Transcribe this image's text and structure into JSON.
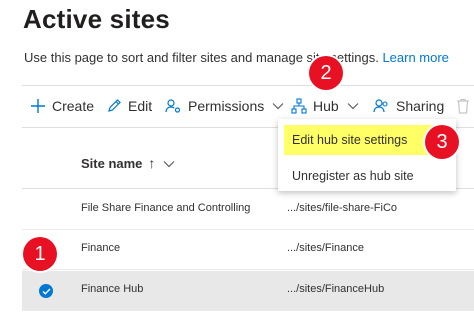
{
  "page": {
    "title": "Active sites",
    "description": "Use this page to sort and filter sites and manage site settings.",
    "learn_more": "Learn more"
  },
  "toolbar": {
    "create": "Create",
    "edit": "Edit",
    "permissions": "Permissions",
    "hub": "Hub",
    "sharing": "Sharing"
  },
  "hub_menu": {
    "items": [
      "Edit hub site settings",
      "Unregister as hub site"
    ]
  },
  "table": {
    "column_site_name": "Site name",
    "sort_arrow": "↑",
    "rows": [
      {
        "name": "File Share Finance and Controlling",
        "url": ".../sites/file-share-FiCo",
        "selected": false
      },
      {
        "name": "Finance",
        "url": ".../sites/Finance",
        "selected": false
      },
      {
        "name": "Finance Hub",
        "url": ".../sites/FinanceHub",
        "selected": true
      }
    ]
  },
  "callouts": [
    "1",
    "2",
    "3"
  ],
  "colors": {
    "accent": "#0078d4",
    "callout": "#e81123",
    "highlight": "#ffff66",
    "selected_row": "#e8e8e8"
  }
}
